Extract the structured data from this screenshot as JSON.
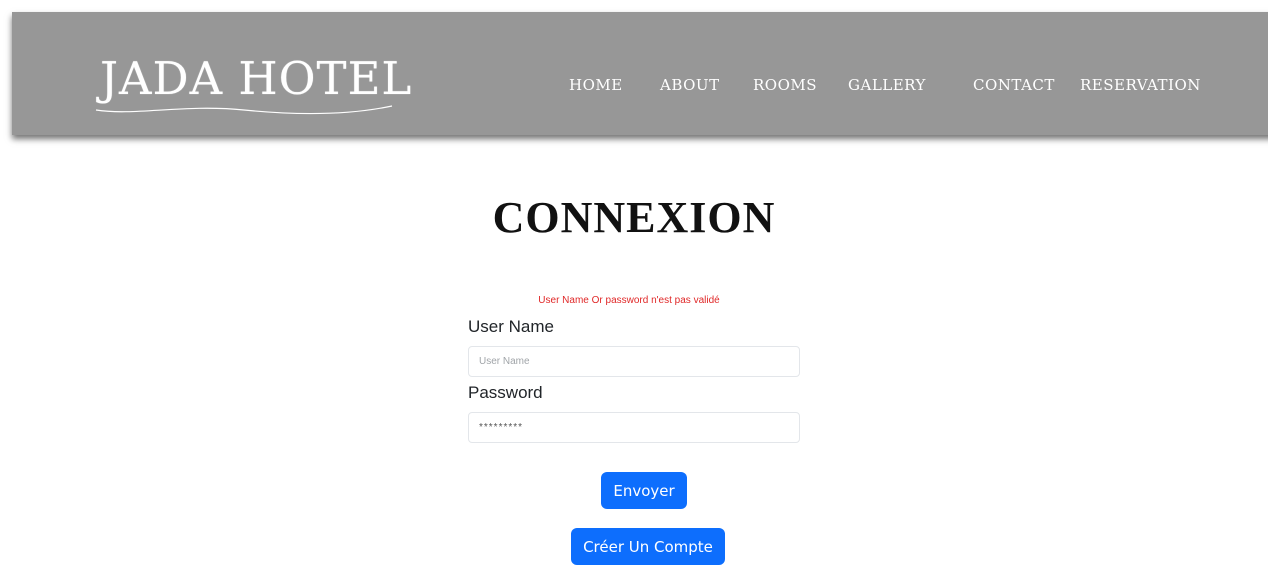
{
  "header": {
    "logo": "JADA HOTEL",
    "nav": [
      "HOME",
      "ABOUT",
      "ROOMS",
      "GALLERY",
      "CONTACT",
      "RESERVATION"
    ]
  },
  "page": {
    "title": "CONNEXION"
  },
  "form": {
    "error": "User Name Or password n'est pas validé",
    "username_label": "User Name",
    "username_placeholder": "User Name",
    "password_label": "Password",
    "password_value": "*********",
    "submit_label": "Envoyer",
    "create_account_label": "Créer Un Compte"
  },
  "colors": {
    "navbar": "#979797",
    "primary": "#0d6efd",
    "error": "#e02828"
  }
}
